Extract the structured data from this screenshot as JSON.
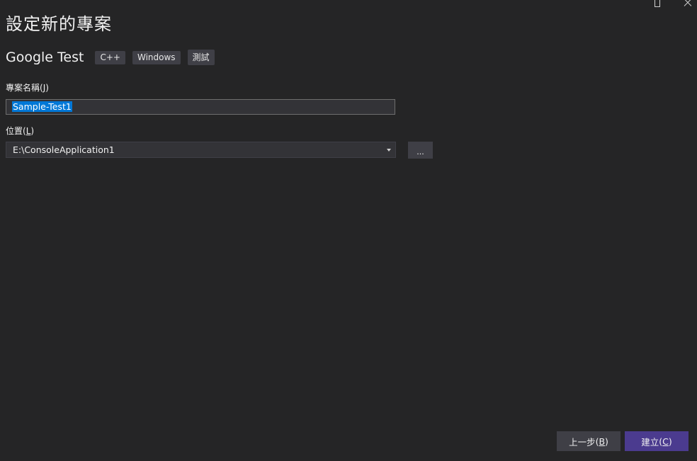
{
  "page": {
    "title": "設定新的專案"
  },
  "template": {
    "name": "Google Test",
    "tags": [
      "C++",
      "Windows",
      "測試"
    ]
  },
  "project_name": {
    "label": "專案名稱",
    "access_key": "J",
    "value": "Sample-Test1"
  },
  "location": {
    "label": "位置",
    "access_key": "L",
    "value": "E:\\ConsoleApplication1",
    "browse_label": "..."
  },
  "footer": {
    "back_label": "上一步",
    "back_key": "B",
    "create_label": "建立",
    "create_key": "C"
  },
  "colors": {
    "background": "#252526",
    "input_bg": "#333337",
    "selection": "#0078d7",
    "primary_button": "#4b3b8f",
    "secondary_button": "#3f3f46"
  }
}
